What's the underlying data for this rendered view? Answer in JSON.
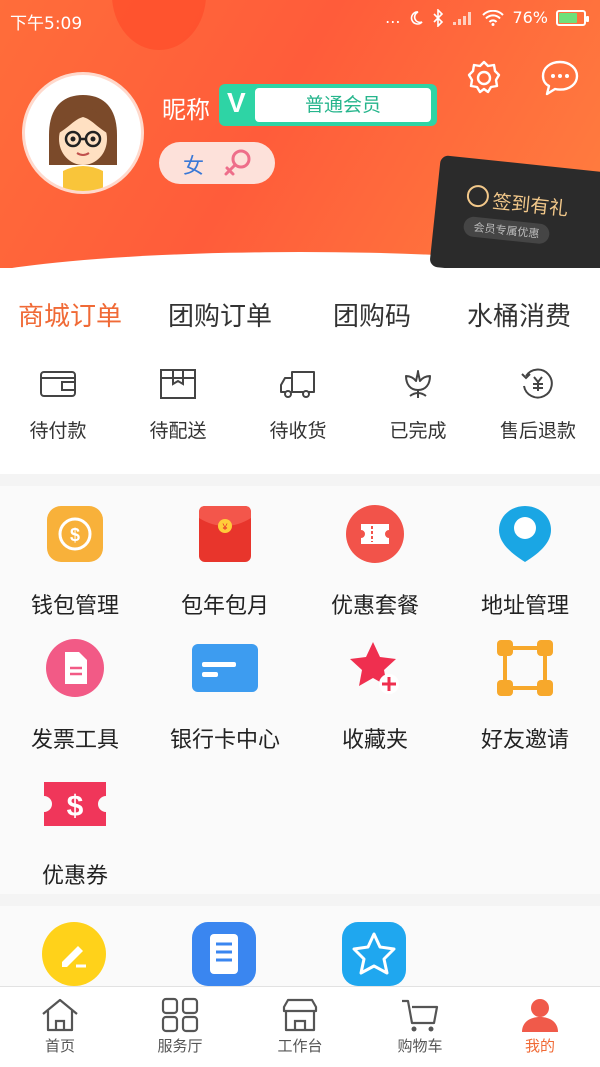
{
  "status_bar": {
    "time": "下午5:09",
    "dots": "...",
    "battery": "76%",
    "battery_level": 0.76
  },
  "profile": {
    "nickname": "昵称",
    "vip_mark": "V",
    "member_level": "普通会员",
    "gender": "女"
  },
  "signin_card": {
    "title": "签到有礼",
    "subtitle": "会员专属优惠"
  },
  "order_tabs": [
    {
      "label": "商城订单",
      "active": true
    },
    {
      "label": "团购订单",
      "active": false
    },
    {
      "label": "团购码",
      "active": false
    },
    {
      "label": "水桶消费",
      "active": false
    }
  ],
  "order_status": [
    {
      "label": "待付款",
      "icon": "wallet-icon"
    },
    {
      "label": "待配送",
      "icon": "package-icon"
    },
    {
      "label": "待收货",
      "icon": "truck-icon"
    },
    {
      "label": "已完成",
      "icon": "flower-icon"
    },
    {
      "label": "售后退款",
      "icon": "refund-icon"
    }
  ],
  "services": [
    {
      "label": "钱包管理",
      "icon": "wallet-coin-icon",
      "color": "#f8b13a"
    },
    {
      "label": "包年包月",
      "icon": "red-envelope-icon",
      "color": "#e8352c"
    },
    {
      "label": "优惠套餐",
      "icon": "ticket-icon",
      "color": "#f2534a"
    },
    {
      "label": "地址管理",
      "icon": "location-pin-icon",
      "color": "#1aa6e4"
    },
    {
      "label": "发票工具",
      "icon": "invoice-icon",
      "color": "#f25a86"
    },
    {
      "label": "银行卡中心",
      "icon": "bank-card-icon",
      "color": "#3d9cf0"
    },
    {
      "label": "收藏夹",
      "icon": "star-plus-icon",
      "color": "#ef2f4f"
    },
    {
      "label": "好友邀请",
      "icon": "invite-network-icon",
      "color": "#f7a82b"
    },
    {
      "label": "优惠券",
      "icon": "coupon-dollar-icon",
      "color": "#f0365a"
    }
  ],
  "tools": [
    {
      "icon": "pencil-icon",
      "color": "#ffd21a"
    },
    {
      "icon": "document-icon",
      "color": "#3a86f0"
    },
    {
      "icon": "star-icon",
      "color": "#1fa7ef"
    }
  ],
  "tab_bar": [
    {
      "label": "首页",
      "icon": "home-icon",
      "active": false
    },
    {
      "label": "服务厅",
      "icon": "grid-icon",
      "active": false
    },
    {
      "label": "工作台",
      "icon": "store-icon",
      "active": false
    },
    {
      "label": "购物车",
      "icon": "cart-icon",
      "active": false
    },
    {
      "label": "我的",
      "icon": "user-icon",
      "active": true
    }
  ]
}
